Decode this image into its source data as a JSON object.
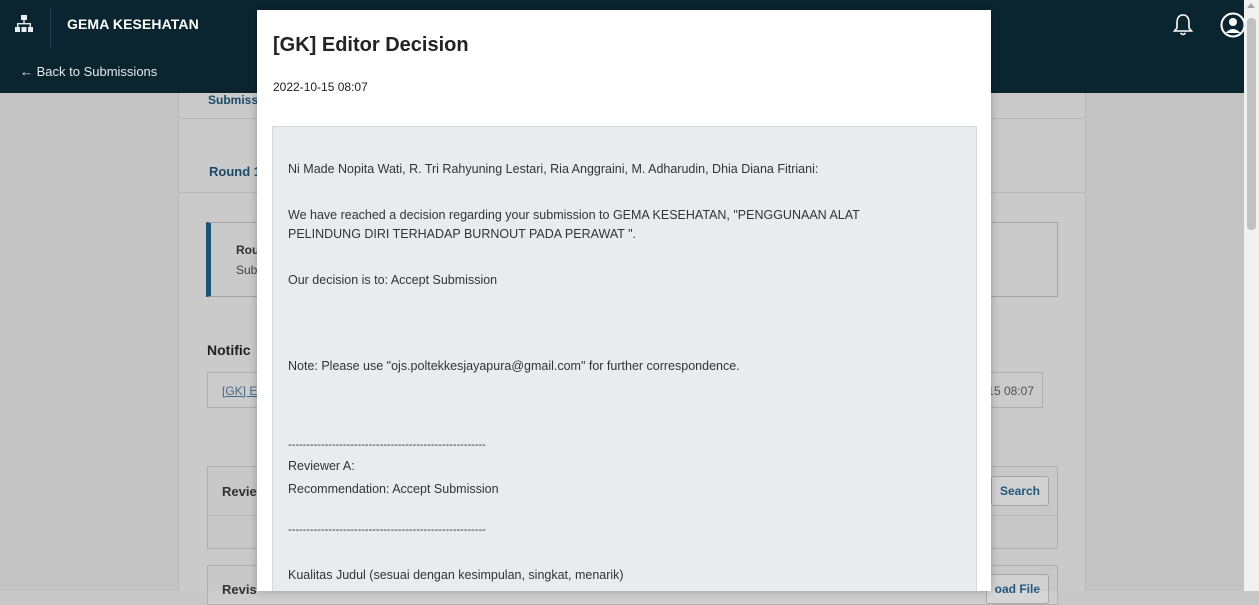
{
  "header": {
    "journal_name": "GEMA KESEHATAN",
    "back_link": "← Back to Submissions"
  },
  "background": {
    "tab_submission": "Submiss",
    "tab_round": "Round 1",
    "round_box_title": "Rou",
    "round_box_sub": "Subr",
    "notifications_title": "Notific",
    "notification_link": "[GK] E",
    "notification_date": "15 08:07",
    "review_panel_title": "Revie",
    "review_panel_button": "Search",
    "revision_panel_title": "Revis",
    "revision_panel_button": "oad File"
  },
  "modal": {
    "title": "[GK] Editor Decision",
    "date": "2022-10-15 08:07",
    "body": {
      "salutation": "Ni Made Nopita Wati, R. Tri Rahyuning Lestari, Ria Anggraini, M. Adharudin, Dhia Diana Fitriani:",
      "intro": "We have reached a decision regarding your submission to GEMA KESEHATAN, \"PENGGUNAAN ALAT PELINDUNG DIRI TERHADAP BURNOUT PADA PERAWAT \".",
      "decision": "Our decision is to: Accept Submission",
      "note": "Note: Please use \"ojs.poltekkesjayapura@gmail.com\" for further correspondence.",
      "separator": "------------------------------------------------------",
      "reviewer": "Reviewer A:",
      "recommendation": "Recommendation: Accept Submission",
      "criterion": "Kualitas Judul (sesuai dengan kesimpulan, singkat, menarik)"
    }
  },
  "colors": {
    "header_bg": "#0b2530",
    "accent": "#1d5578",
    "email_bg": "#e9ecee"
  }
}
